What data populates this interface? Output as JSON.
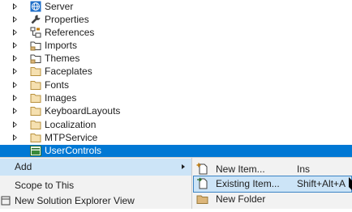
{
  "tree": {
    "items": [
      {
        "label": "Server",
        "icon": "globe-icon"
      },
      {
        "label": "Properties",
        "icon": "wrench-icon"
      },
      {
        "label": "References",
        "icon": "references-icon"
      },
      {
        "label": "Imports",
        "icon": "imports-icon"
      },
      {
        "label": "Themes",
        "icon": "themes-icon"
      },
      {
        "label": "Faceplates",
        "icon": "folder-icon"
      },
      {
        "label": "Fonts",
        "icon": "folder-icon"
      },
      {
        "label": "Images",
        "icon": "folder-icon"
      },
      {
        "label": "KeyboardLayouts",
        "icon": "folder-icon"
      },
      {
        "label": "Localization",
        "icon": "folder-icon"
      },
      {
        "label": "MTPService",
        "icon": "folder-icon"
      },
      {
        "label": "UserControls",
        "icon": "usercontrol-icon",
        "selected": true
      }
    ]
  },
  "context_menu": {
    "items": [
      {
        "label": "Add",
        "has_submenu": true,
        "highlighted": true
      },
      {
        "label": "Scope to This"
      },
      {
        "label": "New Solution Explorer View",
        "icon": "new-view-icon"
      }
    ]
  },
  "submenu": {
    "items": [
      {
        "label": "New Item...",
        "shortcut": "Ins",
        "icon": "new-item-icon"
      },
      {
        "label": "Existing Item...",
        "shortcut": "Shift+Alt+A",
        "icon": "existing-item-icon",
        "highlighted": true
      },
      {
        "label": "New Folder",
        "icon": "new-folder-icon"
      }
    ]
  },
  "colors": {
    "selection": "#0078d4",
    "menu_background": "#f2f2f2",
    "menu_highlight": "#cce4f7",
    "folder": "#dcb67a"
  }
}
